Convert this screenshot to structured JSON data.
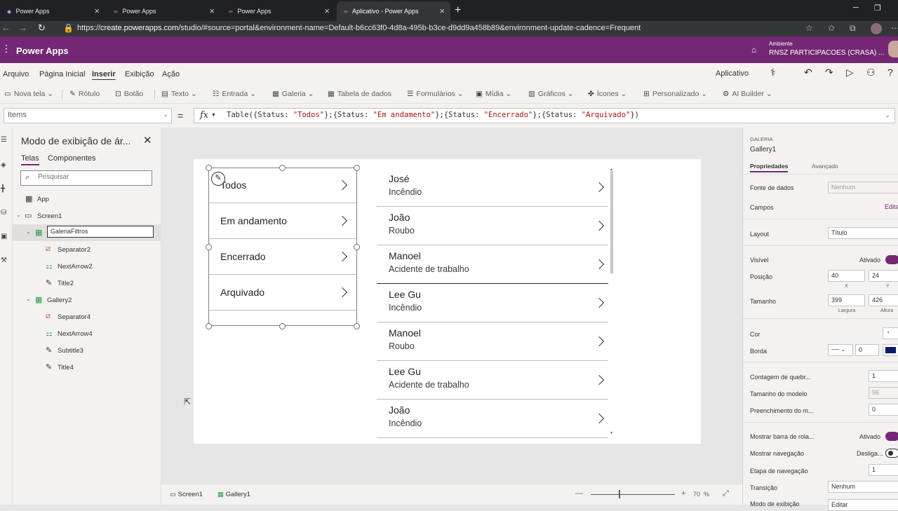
{
  "browser": {
    "tabs": [
      {
        "label": "Power Apps"
      },
      {
        "label": "Power Apps"
      },
      {
        "label": "Power Apps"
      },
      {
        "label": "Aplicativo - Power Apps"
      }
    ],
    "url_prefix": "https://",
    "url_host": "create.powerapps.com",
    "url_rest": "/studio/#source=portal&environment-name=Default-b6cc63f0-4d8a-495b-b3ce-d9dd9a458b89&environment-update-cadence=Frequent"
  },
  "app": {
    "name": "Power Apps",
    "env_label": "Ambiente",
    "env_name": "RNSZ PARTICIPACOES (CRASA) ..."
  },
  "menu": {
    "items": [
      "Arquivo",
      "Página Inicial",
      "Inserir",
      "Exibição",
      "Ação"
    ],
    "active": "Inserir",
    "right_label": "Aplicativo"
  },
  "ribbon": {
    "items": [
      "Nova tela",
      "Rótulo",
      "Botão",
      "Texto",
      "Entrada",
      "Galeria",
      "Tabela de dados",
      "Formulários",
      "Mídia",
      "Gráficos",
      "Ícones",
      "Personalizado",
      "AI Builder"
    ]
  },
  "formula_bar": {
    "property": "Items",
    "equals": "=",
    "fx": "fx",
    "formula_parts": [
      "Table({Status: ",
      "\"Todos\"",
      "};{Status: ",
      "\"Em andamento\"",
      "};{Status: ",
      "\"Encerrado\"",
      "};{Status: ",
      "\"Arquivado\"",
      "})"
    ]
  },
  "tree": {
    "title": "Modo de exibição de ár...",
    "tabs": [
      "Telas",
      "Componentes"
    ],
    "search_placeholder": "Pesquisar",
    "nodes": {
      "app": "App",
      "screen1": "Screen1",
      "galeria_filtros": "GaleriaFiltros",
      "separator2": "Separator2",
      "nextarrow2": "NextArrow2",
      "title2": "Title2",
      "gallery2": "Gallery2",
      "separator4": "Separator4",
      "nextarrow4": "NextArrow4",
      "subtitle3": "Subtitle3",
      "title4": "Title4"
    }
  },
  "filter_gallery": [
    "Todos",
    "Em andamento",
    "Encerrado",
    "Arquivado"
  ],
  "cases_gallery": [
    {
      "name": "José",
      "type": "Incêndio"
    },
    {
      "name": "João",
      "type": "Roubo"
    },
    {
      "name": "Manoel",
      "type": "Acidente de trabalho"
    },
    {
      "name": "Lee Gu",
      "type": "Incêndio"
    },
    {
      "name": "Manoel",
      "type": "Roubo"
    },
    {
      "name": "Lee Gu",
      "type": "Acidente de trabalho"
    },
    {
      "name": "João",
      "type": "Incêndio"
    }
  ],
  "statusbar": {
    "screen": "Screen1",
    "control": "Gallery1",
    "zoom": "70",
    "zoom_unit": "%",
    "minus": "—",
    "plus": "+"
  },
  "properties": {
    "control_type": "GALERIA",
    "control_name": "Gallery1",
    "tabs": [
      "Propriedades",
      "Avançado"
    ],
    "fonte_label": "Fonte de dados",
    "fonte_value": "Nenhum",
    "campos_label": "Campos",
    "campos_edit": "Edita",
    "layout_label": "Layout",
    "layout_value": "Título",
    "visivel_label": "Visível",
    "visivel_value": "Ativado",
    "posicao_label": "Posição",
    "pos_x": "40",
    "pos_y": "24",
    "x_label": "X",
    "y_label": "Y",
    "tamanho_label": "Tamanho",
    "largura": "399",
    "altura": "426",
    "largura_label": "Largura",
    "altura_label": "Altura",
    "cor_label": "Cor",
    "borda_label": "Borda",
    "borda_width": "0",
    "border_color": "#0b1a6b",
    "wrap_label": "Contagem de quebr...",
    "wrap_value": "1",
    "template_size_label": "Tamanho do modelo",
    "template_size_value": "96",
    "template_padding_label": "Preenchimento do m...",
    "template_padding_value": "0",
    "scrollbar_label": "Mostrar barra de rola...",
    "scrollbar_value": "Ativado",
    "nav_label": "Mostrar navegação",
    "nav_value": "Desliga...",
    "nav_step_label": "Etapa de navegação",
    "nav_step_value": "1",
    "transition_label": "Transição",
    "transition_value": "Nenhum",
    "display_mode_label": "Modo de exibição",
    "display_mode_value": "Editar"
  },
  "colors": {
    "brand": "#742774",
    "browser_dark": "#202124",
    "canvas": "#e6e6e6"
  }
}
